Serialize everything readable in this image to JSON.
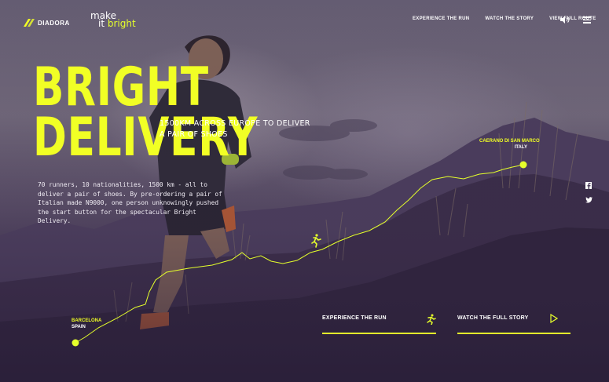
{
  "brand": {
    "name": "DIADORA"
  },
  "campaign": {
    "line1": "make",
    "line2a": "it ",
    "line2b": "bright"
  },
  "nav": {
    "items": [
      "EXPERIENCE THE RUN",
      "WATCH THE STORY",
      "VIEW FULL ROUTE"
    ]
  },
  "hero": {
    "title_line1": "BRIGHT",
    "title_line2": "DELIVERY",
    "subtitle": "1500KM ACROSS EUROPE TO DELIVER A PAIR OF SHOES",
    "description": "70 runners, 10 nationalities, 1500 km - all to deliver a pair of shoes. By pre-ordering a pair of Italian made N9000, one person unknowingly pushed the start button for the spectacular Bright Delivery."
  },
  "route": {
    "start": {
      "city": "BARCELONA",
      "country": "SPAIN"
    },
    "end": {
      "city": "CAERANO DI SAN MARCO",
      "country": "ITALY"
    }
  },
  "cta": {
    "experience": "EXPERIENCE THE RUN",
    "watch": "WATCH THE FULL STORY"
  },
  "social": [
    "facebook-icon",
    "twitter-icon"
  ],
  "colors": {
    "accent": "#f1ff25",
    "overlay": "#3c2f4d"
  }
}
